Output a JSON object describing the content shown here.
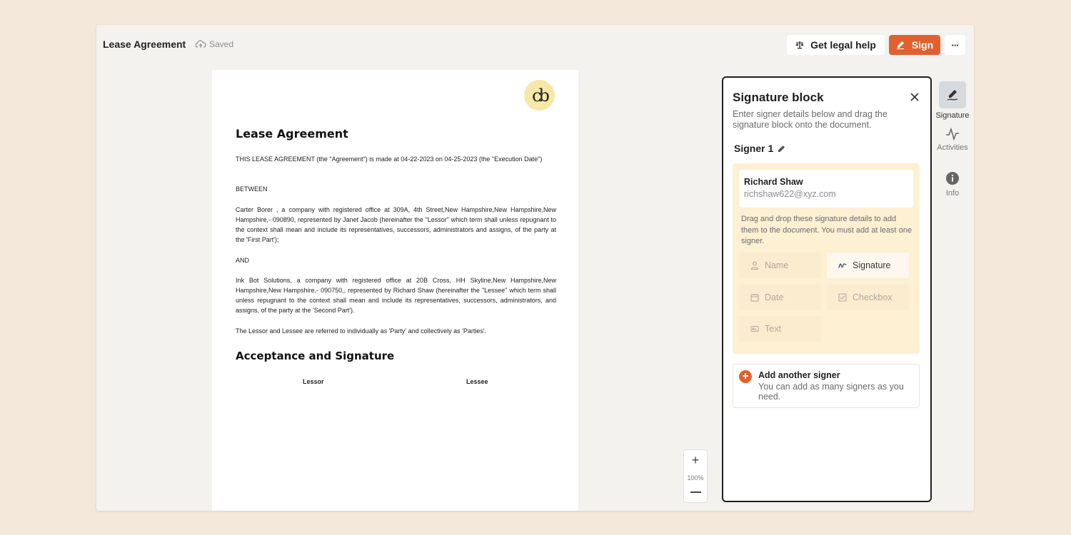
{
  "topbar": {
    "title": "Lease Agreement",
    "saved_label": "Saved",
    "legal_help_label": "Get legal help",
    "sign_label": "Sign",
    "more_label": "···"
  },
  "document": {
    "logo_text": "cb",
    "heading": "Lease Agreement",
    "para1": "THIS LEASE AGREEMENT (the \"Agreement\") is made at 04-22-2023 on 04-25-2023 (the \"Execution Date\")",
    "between": "BETWEEN",
    "para2": "Carter Borer , a company with registered office at 309A, 4th Street,New Hampshire,New Hampshire,New Hampshire,- 090890, represented by Janet Jacob (hereinafter the \"Lessor\" which term shall unless repugnant to the context shall mean and include its representatives, successors, administrators and assigns, of the party at the 'First Part');",
    "and": "AND",
    "para3": "Ink Bot Solutions, a company with registered office at 20B Cross, HH Skyline,New Hampshire,New Hampshire,New Hampshire,- 090750,, represented by Richard Shaw (hereinafter the \"Lessee\" which term shall unless repugnant to the context shall mean and include its representatives, successors, administrators, and assigns, of the party at the 'Second Part').",
    "para4": "The Lessor and Lessee are referred to individually as 'Party' and collectively as 'Parties'.",
    "section_heading": "Acceptance and Signature",
    "lessor_label": "Lessor",
    "lessee_label": "Lessee"
  },
  "zoom": {
    "plus": "+",
    "level": "100%"
  },
  "panel": {
    "title": "Signature block",
    "subtitle": "Enter signer details below and drag the signature block onto the document.",
    "signer_label": "Signer 1",
    "signer_name": "Richard Shaw",
    "signer_email": "richshaw622@xyz.com",
    "hint": "Drag and drop these signature details to add them to the document. You must add at least one signer.",
    "fields": {
      "name": "Name",
      "signature": "Signature",
      "date": "Date",
      "checkbox": "Checkbox",
      "text": "Text"
    },
    "add_signer_title": "Add another signer",
    "add_signer_sub": "You can add as many signers as you need."
  },
  "rail": {
    "signature": "Signature",
    "activities": "Activities",
    "info": "Info"
  },
  "colors": {
    "accent": "#e0612f",
    "signer_bg": "#fdf0d3",
    "page_bg": "#f3e8da"
  }
}
